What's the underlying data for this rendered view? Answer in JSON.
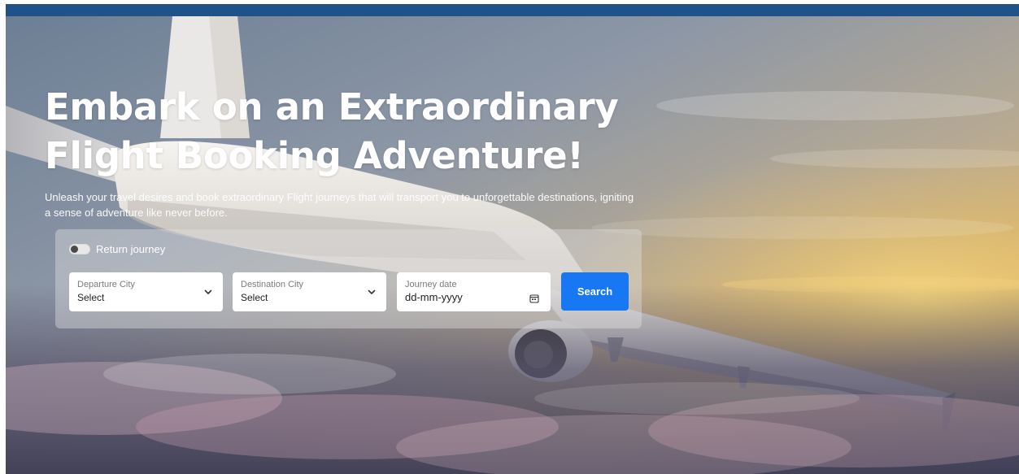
{
  "hero": {
    "title_line1": "Embark on an Extraordinary",
    "title_line2": "Flight Booking Adventure!",
    "subtitle_line1": "Unleash your travel desires and book extraordinary Flight journeys that will transport you to unforgettable destinations, igniting",
    "subtitle_line2": "a sense of adventure like never before."
  },
  "booking": {
    "return_toggle": {
      "label": "Return journey",
      "checked": false
    },
    "departure": {
      "label": "Departure City",
      "value": "Select",
      "icon": "chevron-down-icon"
    },
    "destination": {
      "label": "Destination City",
      "value": "Select",
      "icon": "chevron-down-icon"
    },
    "journey_date": {
      "label": "Journey date",
      "placeholder": "dd-mm-yyyy",
      "icon": "calendar-icon"
    },
    "search_label": "Search"
  },
  "colors": {
    "top_bar": "#1e5288",
    "search_button": "#1877f2",
    "text_white": "#ffffff"
  }
}
